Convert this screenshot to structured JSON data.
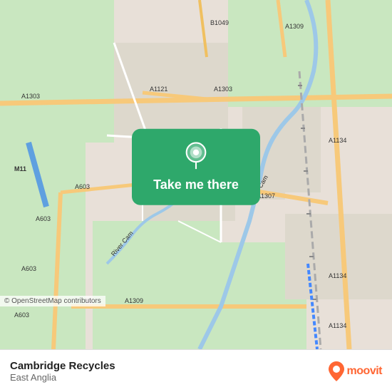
{
  "map": {
    "attribution": "© OpenStreetMap contributors"
  },
  "overlay": {
    "button_label": "Take me there",
    "pin_icon": "location-pin"
  },
  "bottom_bar": {
    "location_name": "Cambridge Recycles",
    "location_region": "East Anglia",
    "logo_text": "moovit"
  }
}
